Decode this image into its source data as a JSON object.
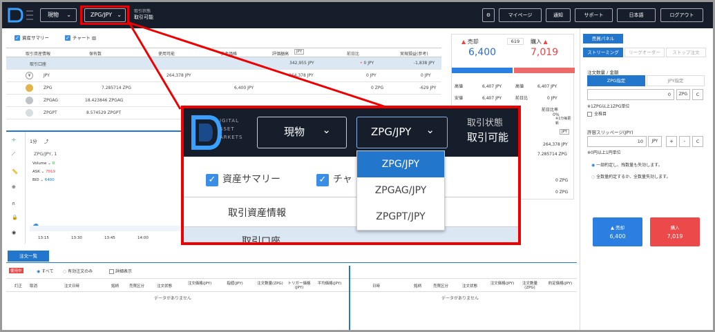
{
  "header": {
    "mode_select": "現物",
    "pair_select": "ZPG/JPY",
    "status_label": "取引状態",
    "status_value": "取引可能",
    "buttons": [
      "マイページ",
      "通知",
      "サポート",
      "日本語",
      "ログアウト"
    ]
  },
  "summary": {
    "toggle_asset": "資産サマリー",
    "toggle_chart": "チャート",
    "columns": [
      "取引資産情報",
      "保有数",
      "使用可能",
      "参考価格",
      "評価額⁠高",
      "前日比",
      "実現損益(参考)"
    ],
    "columns_display": [
      "取引資産情報",
      "保有数",
      "使用可能",
      "参考価格",
      "評価額高",
      "前日比",
      "実現損益(参考)"
    ],
    "valuation_unit": "JPY",
    "account_row": {
      "label": "取引口座",
      "valuation": "342,955 JPY",
      "change": "0 JPY",
      "realized": "-1,838 JPY"
    },
    "rows": [
      {
        "name": "JPY",
        "holdings": "",
        "available": "264,378 JPY",
        "price": "",
        "valuation": "264,378 JPY",
        "change": "0 JPY",
        "realized": "0 JPY"
      },
      {
        "name": "ZPG",
        "holdings": "7.285714 ZPG",
        "available": "",
        "price": "6,400 JPY",
        "valuation": "46,628 JPY",
        "change": "0 ZPG",
        "realized": "-629 JPY"
      },
      {
        "name": "ZPGAG",
        "holdings": "18.423846 ZPGAG",
        "available": "",
        "price": "",
        "valuation": "",
        "change": "",
        "realized": ""
      },
      {
        "name": "ZPGPT",
        "holdings": "8.574529 ZPGPT",
        "available": "",
        "price": "",
        "valuation": "",
        "change": "",
        "realized": ""
      }
    ]
  },
  "chart": {
    "interval": "1分",
    "symbol": "ZPG/JPY, 1",
    "volume_label": "Volume",
    "volume_value": "0",
    "ask_label": "ASK",
    "ask_value": "7019",
    "bid_label": "BID",
    "bid_value": "6400",
    "times": [
      "13:15",
      "13:30",
      "13:45",
      "14:00"
    ]
  },
  "board": {
    "sell_label": "売却",
    "sell_price": "6,400",
    "spread": "619",
    "buy_label": "購入",
    "buy_price": "7,019",
    "rows_left": [
      [
        "高値",
        "6,407 JPY"
      ],
      [
        "安値",
        "6,407 JPY"
      ]
    ],
    "rows_right": [
      [
        "高値",
        "6,407 JPY"
      ],
      [
        "前日比",
        "0 JPY"
      ],
      [
        "前日比率",
        "0%"
      ]
    ],
    "note": "※1分毎更新",
    "unit": "JPY",
    "holding_jpy": "264,378 JPY",
    "holding_zpg": "7.285714 ZPG",
    "zero_a": "0 ZPG",
    "zero_b": "0 ZPG"
  },
  "order_panel": {
    "title": "売買パネル",
    "tabs": [
      "ストリーミング",
      "リーグオーダー",
      "ストップ注文"
    ],
    "qty_label": "注文数量 / 金額",
    "mode_zpg": "ZPG指定",
    "mode_jpy": "JPY指定",
    "qty_value": "0",
    "qty_unit": "ZPG",
    "qty_clear": "C",
    "note": "※1ZPG以上1ZPG単位",
    "all_label": "全株目",
    "slip_label": "許容スリッページ(JPY)",
    "slip_value": "10",
    "slip_unit": "JPY",
    "slip_plus": "+",
    "slip_minus": "-",
    "slip_clear": "C",
    "slip_note": "※0円以上1円単位",
    "radio1": "一部約定し、残数量も失効します。",
    "radio2": "全数量約定するか、全数量失効します。",
    "sell_btn": "売却",
    "sell_btn_price": "6,400",
    "buy_btn": "購入",
    "buy_btn_price": "7,019"
  },
  "orders": {
    "tab": "注文一覧",
    "badge": "使用中",
    "filter_all": "すべて",
    "filter_valid": "有効注文のみ",
    "filter_detail": "詳細表示",
    "cols_left": [
      "訂正",
      "取消",
      "注文日時",
      "銘柄",
      "売買区分",
      "注文状態",
      "注文価格(JPY)",
      "指値(JPY)",
      "注文数量(ZPG)",
      "トリガー価格(JPY)",
      "平均価格(JPY)"
    ],
    "cols_right": [
      "日時",
      "銘柄",
      "売買区分",
      "注文状態",
      "注文価格(JPY)",
      "注文数量(ZPG)",
      "約定価格(JPY)"
    ],
    "empty": "データがありません"
  },
  "zoom": {
    "logo_lines": [
      "IGITAL",
      "SSET",
      "ARKETS"
    ],
    "mode_select": "現物",
    "pair_select": "ZPG/JPY",
    "status_label": "取引状態",
    "status_value": "取引可能",
    "toggle_asset": "資産サマリー",
    "toggle_chart": "チャ",
    "section_title": "取引資産情報",
    "account_row": "取引口座",
    "options": [
      "ZPG/JPY",
      "ZPGAG/JPY",
      "ZPGPT/JPY"
    ],
    "selected_index": 0
  },
  "colors": {
    "navy": "#161d2b",
    "red": "#e00000",
    "blue": "#2277cc",
    "sell": "#2a7fe0",
    "buy": "#ec4a4a"
  }
}
